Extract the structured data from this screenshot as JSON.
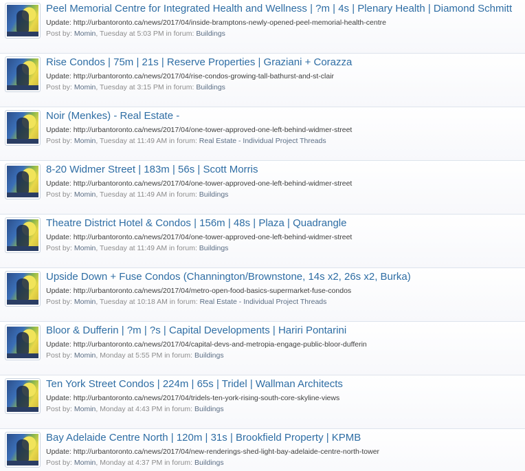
{
  "results": [
    {
      "title": "Peel Memorial Centre for Integrated Health and Wellness | ?m | 4s | Plenary Health | Diamond Schmitt",
      "snippet": "Update: http://urbantoronto.ca/news/2017/04/inside-bramptons-newly-opened-peel-memorial-health-centre",
      "post_by_label": "Post by:",
      "author": "Momin",
      "time": "Tuesday at 5:03 PM",
      "forum_label": "in forum:",
      "forum": "Buildings"
    },
    {
      "title": "Rise Condos | 75m | 21s | Reserve Properties | Graziani + Corazza",
      "snippet": "Update: http://urbantoronto.ca/news/2017/04/rise-condos-growing-tall-bathurst-and-st-clair",
      "post_by_label": "Post by:",
      "author": "Momin",
      "time": "Tuesday at 3:15 PM",
      "forum_label": "in forum:",
      "forum": "Buildings"
    },
    {
      "title": "Noir (Menkes) - Real Estate -",
      "snippet": "Update: http://urbantoronto.ca/news/2017/04/one-tower-approved-one-left-behind-widmer-street",
      "post_by_label": "Post by:",
      "author": "Momin",
      "time": "Tuesday at 11:49 AM",
      "forum_label": "in forum:",
      "forum": "Real Estate - Individual Project Threads"
    },
    {
      "title": "8-20 Widmer Street | 183m | 56s | Scott Morris",
      "snippet": "Update: http://urbantoronto.ca/news/2017/04/one-tower-approved-one-left-behind-widmer-street",
      "post_by_label": "Post by:",
      "author": "Momin",
      "time": "Tuesday at 11:49 AM",
      "forum_label": "in forum:",
      "forum": "Buildings"
    },
    {
      "title": "Theatre District Hotel & Condos | 156m | 48s | Plaza | Quadrangle",
      "snippet": "Update: http://urbantoronto.ca/news/2017/04/one-tower-approved-one-left-behind-widmer-street",
      "post_by_label": "Post by:",
      "author": "Momin",
      "time": "Tuesday at 11:49 AM",
      "forum_label": "in forum:",
      "forum": "Buildings"
    },
    {
      "title": "Upside Down + Fuse Condos (Channington/Brownstone, 14s x2, 26s x2, Burka)",
      "snippet": "Update: http://urbantoronto.ca/news/2017/04/metro-open-food-basics-supermarket-fuse-condos",
      "post_by_label": "Post by:",
      "author": "Momin",
      "time": "Tuesday at 10:18 AM",
      "forum_label": "in forum:",
      "forum": "Real Estate - Individual Project Threads"
    },
    {
      "title": "Bloor & Dufferin | ?m | ?s | Capital Developments | Hariri Pontarini",
      "snippet": "Update: http://urbantoronto.ca/news/2017/04/capital-devs-and-metropia-engage-public-bloor-dufferin",
      "post_by_label": "Post by:",
      "author": "Momin",
      "time": "Monday at 5:55 PM",
      "forum_label": "in forum:",
      "forum": "Buildings"
    },
    {
      "title": "Ten York Street Condos | 224m | 65s | Tridel | Wallman Architects",
      "snippet": "Update: http://urbantoronto.ca/news/2017/04/tridels-ten-york-rising-south-core-skyline-views",
      "post_by_label": "Post by:",
      "author": "Momin",
      "time": "Monday at 4:43 PM",
      "forum_label": "in forum:",
      "forum": "Buildings"
    },
    {
      "title": "Bay Adelaide Centre North | 120m | 31s | Brookfield Property | KPMB",
      "snippet": "Update: http://urbantoronto.ca/news/2017/04/new-renderings-shed-light-bay-adelaide-centre-north-tower",
      "post_by_label": "Post by:",
      "author": "Momin",
      "time": "Monday at 4:37 PM",
      "forum_label": "in forum:",
      "forum": "Buildings"
    }
  ]
}
